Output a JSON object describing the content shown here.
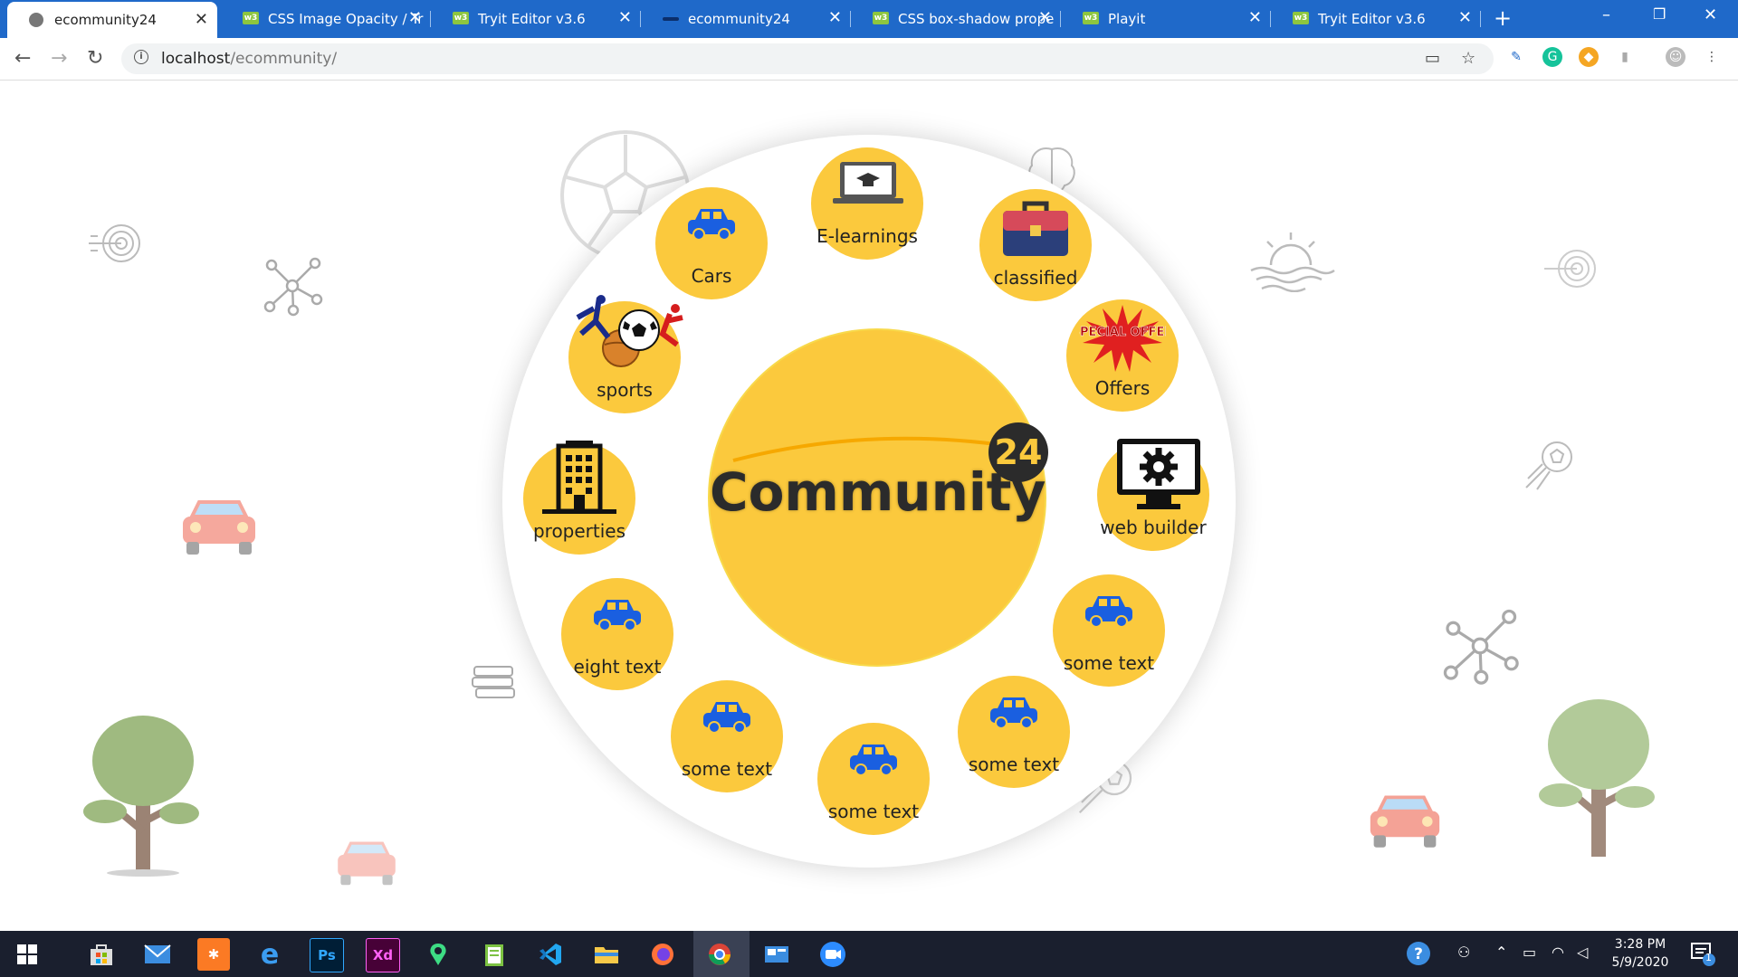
{
  "browser": {
    "tabs": [
      {
        "title": "ecommunity24",
        "active": true
      },
      {
        "title": "CSS Image Opacity / Tr",
        "active": false
      },
      {
        "title": "Tryit Editor v3.6",
        "active": false
      },
      {
        "title": "ecommunity24",
        "active": false
      },
      {
        "title": "CSS box-shadow prope",
        "active": false
      },
      {
        "title": "Playit",
        "active": false
      },
      {
        "title": "Tryit Editor v3.6",
        "active": false
      }
    ],
    "tab_favicon_text": "w3",
    "url_host": "localhost",
    "url_path": "/ecommunity/"
  },
  "hub": {
    "title": "Community",
    "badge": "24",
    "color": "#fbc93d"
  },
  "nodes": [
    {
      "label": "E-learnings",
      "icon": "laptop-graduation-icon"
    },
    {
      "label": "classified",
      "icon": "briefcase-icon"
    },
    {
      "label": "Offers",
      "icon": "special-offer-icon",
      "icon_text": "SPECIAL OFFER"
    },
    {
      "label": "web builder",
      "icon": "monitor-gear-icon"
    },
    {
      "label": "some text",
      "icon": "car-icon"
    },
    {
      "label": "some text",
      "icon": "car-icon"
    },
    {
      "label": "some text",
      "icon": "car-icon"
    },
    {
      "label": "some text",
      "icon": "car-icon"
    },
    {
      "label": "eight text",
      "icon": "car-icon"
    },
    {
      "label": "properties",
      "icon": "building-icon"
    },
    {
      "label": "sports",
      "icon": "sports-icon"
    },
    {
      "label": "Cars",
      "icon": "car-icon"
    }
  ],
  "taskbar": {
    "time": "3:28 PM",
    "date": "5/9/2020",
    "notification_count": "1",
    "apps": [
      "start-icon",
      "store-icon",
      "mail-icon",
      "xampp-icon",
      "edge-icon",
      "photoshop-icon",
      "xd-icon",
      "maps-icon",
      "notepad-icon",
      "vscode-icon",
      "explorer-icon",
      "firefox-icon",
      "chrome-icon",
      "taskbar-app-icon",
      "zoom-icon"
    ],
    "app_text": {
      "photoshop": "Ps",
      "xd": "Xd"
    }
  },
  "colors": {
    "tabbar": "#1f69c9",
    "node": "#fbc93d",
    "car_blue": "#1a5fe0",
    "taskbar": "#1a1f2e"
  }
}
